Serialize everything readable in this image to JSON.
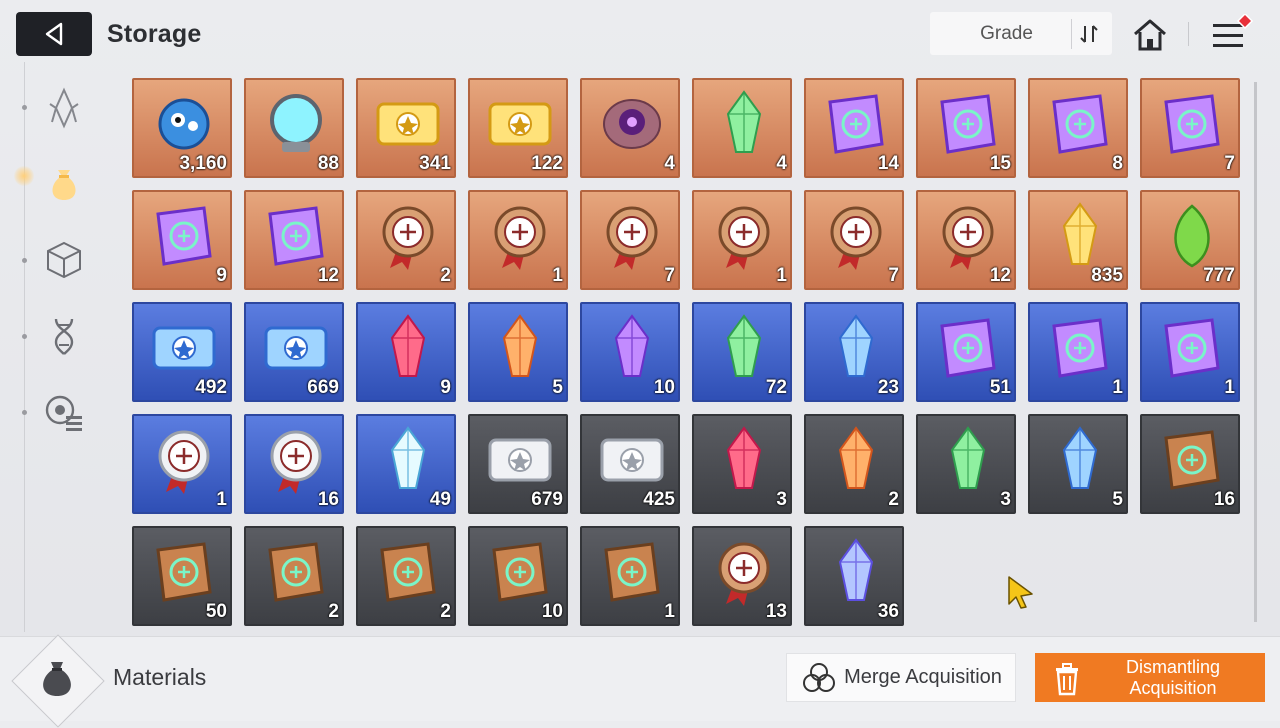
{
  "header": {
    "title": "Storage",
    "grade_label": "Grade"
  },
  "left_rail": {
    "items": [
      {
        "icon": "crystal-icon",
        "active": false
      },
      {
        "icon": "pouch-icon",
        "active": true
      },
      {
        "icon": "cube-icon",
        "active": false
      },
      {
        "icon": "dna-icon",
        "active": false
      },
      {
        "icon": "chip-list-icon",
        "active": false
      }
    ]
  },
  "items": [
    {
      "icon": "blue-creature-icon",
      "rarity": "orange",
      "count": "3,160"
    },
    {
      "icon": "energy-orb-icon",
      "rarity": "orange",
      "count": "88"
    },
    {
      "icon": "gold-ticket-icon",
      "rarity": "orange",
      "count": "341"
    },
    {
      "icon": "gold-star-ticket-icon",
      "rarity": "orange",
      "count": "122"
    },
    {
      "icon": "eye-core-icon",
      "rarity": "orange",
      "count": "4"
    },
    {
      "icon": "green-crystal-icon",
      "rarity": "orange",
      "count": "4"
    },
    {
      "icon": "sword-manual-icon",
      "rarity": "orange",
      "count": "14"
    },
    {
      "icon": "shield-manual-icon",
      "rarity": "orange",
      "count": "15"
    },
    {
      "icon": "eye-manual-icon",
      "rarity": "orange",
      "count": "8"
    },
    {
      "icon": "wing-manual-icon",
      "rarity": "orange",
      "count": "7"
    },
    {
      "icon": "lightning-manual-icon",
      "rarity": "orange",
      "count": "9"
    },
    {
      "icon": "rune-manual-icon",
      "rarity": "orange",
      "count": "12"
    },
    {
      "icon": "sword-medal-icon",
      "rarity": "orange",
      "count": "2"
    },
    {
      "icon": "shield-medal-icon",
      "rarity": "orange",
      "count": "1"
    },
    {
      "icon": "eye-medal-icon",
      "rarity": "orange",
      "count": "7"
    },
    {
      "icon": "wing-medal-icon",
      "rarity": "orange",
      "count": "1"
    },
    {
      "icon": "lightning-medal-icon",
      "rarity": "orange",
      "count": "7"
    },
    {
      "icon": "rune-medal-icon",
      "rarity": "orange",
      "count": "12"
    },
    {
      "icon": "gold-shards-icon",
      "rarity": "orange",
      "count": "835"
    },
    {
      "icon": "green-seed-icon",
      "rarity": "orange",
      "count": "777"
    },
    {
      "icon": "blue-ticket-icon",
      "rarity": "blue",
      "count": "492"
    },
    {
      "icon": "blue-star-ticket-icon",
      "rarity": "blue",
      "count": "669"
    },
    {
      "icon": "red-crystal-icon",
      "rarity": "blue",
      "count": "9"
    },
    {
      "icon": "orange-crystal-icon",
      "rarity": "blue",
      "count": "5"
    },
    {
      "icon": "purple-crystal-icon",
      "rarity": "blue",
      "count": "10"
    },
    {
      "icon": "green-crystal-icon",
      "rarity": "blue",
      "count": "72"
    },
    {
      "icon": "blue-crystal-icon",
      "rarity": "blue",
      "count": "23"
    },
    {
      "icon": "shield-manual-icon",
      "rarity": "blue",
      "count": "51"
    },
    {
      "icon": "wing-manual-icon",
      "rarity": "blue",
      "count": "1"
    },
    {
      "icon": "rune-manual-icon",
      "rarity": "blue",
      "count": "1"
    },
    {
      "icon": "wing-badge-icon",
      "rarity": "blue",
      "count": "1"
    },
    {
      "icon": "lightning-badge-icon",
      "rarity": "blue",
      "count": "16"
    },
    {
      "icon": "ice-crystal-icon",
      "rarity": "blue",
      "count": "49"
    },
    {
      "icon": "silver-ticket-icon",
      "rarity": "gray",
      "count": "679"
    },
    {
      "icon": "silver-star-ticket-icon",
      "rarity": "gray",
      "count": "425"
    },
    {
      "icon": "red-gem-icon",
      "rarity": "gray",
      "count": "3"
    },
    {
      "icon": "orange-gem-icon",
      "rarity": "gray",
      "count": "2"
    },
    {
      "icon": "green-gem-icon",
      "rarity": "gray",
      "count": "3"
    },
    {
      "icon": "blue-gem-icon",
      "rarity": "gray",
      "count": "5"
    },
    {
      "icon": "sword-book-icon",
      "rarity": "gray",
      "count": "16"
    },
    {
      "icon": "shield-book-icon",
      "rarity": "gray",
      "count": "50"
    },
    {
      "icon": "eye-book-icon",
      "rarity": "gray",
      "count": "2"
    },
    {
      "icon": "wing-book-icon",
      "rarity": "gray",
      "count": "2"
    },
    {
      "icon": "lightning-book-icon",
      "rarity": "gray",
      "count": "10"
    },
    {
      "icon": "rune-book-icon",
      "rarity": "gray",
      "count": "1"
    },
    {
      "icon": "bronze-medal-icon",
      "rarity": "gray",
      "count": "13"
    },
    {
      "icon": "prism-crystal-icon",
      "rarity": "gray",
      "count": "36"
    }
  ],
  "footer": {
    "category_label": "Materials",
    "merge_label": "Merge Acquisition",
    "dismantle_label": "Dismantling Acquisition"
  },
  "colors": {
    "accent_orange": "#f07a22",
    "rarity_orange": "#d4865f",
    "rarity_blue": "#3f5fc9",
    "rarity_gray": "#4a4c51",
    "notification_red": "#e8303a"
  }
}
